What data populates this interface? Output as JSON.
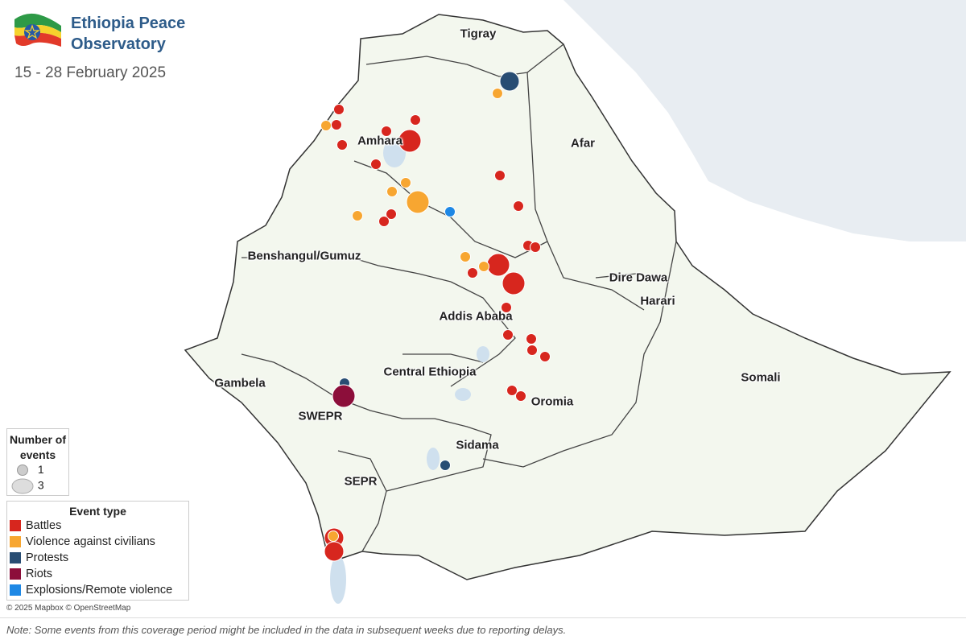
{
  "header": {
    "title": "Ethiopia Peace Observatory",
    "period": "15 - 28 February 2025"
  },
  "colors": {
    "water": "#e8edf2",
    "land_outside": "#ffffff",
    "ethiopia_land": "#f3f7ee",
    "border": "#333333",
    "Battles": "#d7261e",
    "Violence against civilians": "#f7a631",
    "Protests": "#284d73",
    "Riots": "#8c0e3a",
    "Explosions/Remote violence": "#1e88e5"
  },
  "region_labels": [
    {
      "text": "Tigray"
    },
    {
      "text": "Afar"
    },
    {
      "text": "Amhara"
    },
    {
      "text": "Benshangul/Gumuz"
    },
    {
      "text": "Dire Dawa"
    },
    {
      "text": "Harari"
    },
    {
      "text": "Addis Ababa"
    },
    {
      "text": "Somali"
    },
    {
      "text": "Gambela"
    },
    {
      "text": "Central Ethiopia"
    },
    {
      "text": "Oromia"
    },
    {
      "text": "SWEPR"
    },
    {
      "text": "Sidama"
    },
    {
      "text": "SEPR"
    }
  ],
  "legend": {
    "size_title": "Number of events",
    "sizes": [
      "1",
      "3"
    ],
    "type_title": "Event type",
    "types": [
      "Battles",
      "Violence against civilians",
      "Protests",
      "Riots",
      "Explosions/Remote violence"
    ]
  },
  "credit": "© 2025 Mapbox © OpenStreetMap",
  "note": "Note: Some events from this coverage period might be included in the data in subsequent weeks due to reporting delays."
}
